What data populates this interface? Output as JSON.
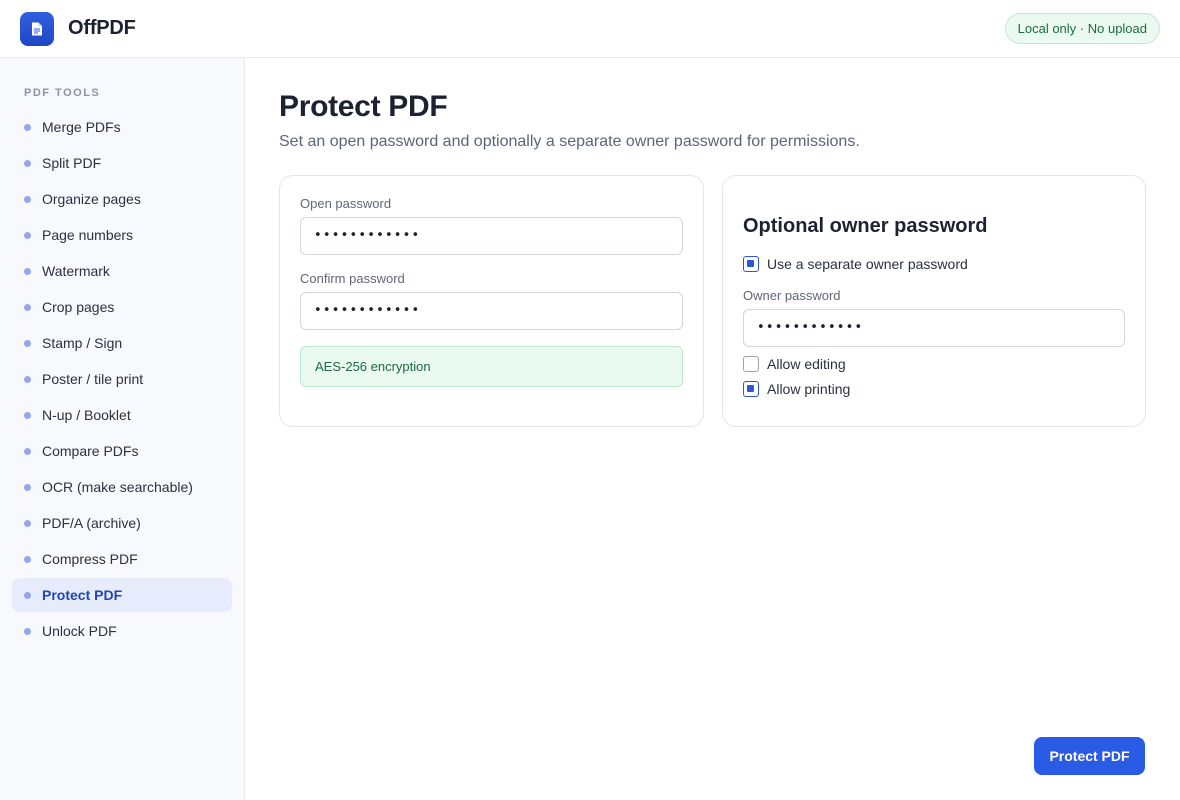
{
  "app": {
    "name": "OffPDF",
    "badge": "Local only · No upload",
    "icon": "document-icon"
  },
  "sidebar": {
    "heading": "PDF TOOLS",
    "items": [
      {
        "label": "Merge PDFs",
        "active": false
      },
      {
        "label": "Split PDF",
        "active": false
      },
      {
        "label": "Organize pages",
        "active": false
      },
      {
        "label": "Page numbers",
        "active": false
      },
      {
        "label": "Watermark",
        "active": false
      },
      {
        "label": "Crop pages",
        "active": false
      },
      {
        "label": "Stamp / Sign",
        "active": false
      },
      {
        "label": "Poster / tile print",
        "active": false
      },
      {
        "label": "N-up / Booklet",
        "active": false
      },
      {
        "label": "Compare PDFs",
        "active": false
      },
      {
        "label": "OCR (make searchable)",
        "active": false
      },
      {
        "label": "PDF/A (archive)",
        "active": false
      },
      {
        "label": "Compress PDF",
        "active": false
      },
      {
        "label": "Protect PDF",
        "active": true
      },
      {
        "label": "Unlock PDF",
        "active": false
      }
    ]
  },
  "main": {
    "title": "Protect PDF",
    "subtitle": "Set an open password and optionally a separate owner password for permissions.",
    "open_password": {
      "label": "Open password",
      "value": "••••••••••••"
    },
    "confirm_password": {
      "label": "Confirm password",
      "value": "••••••••••••"
    },
    "encryption_note": "AES-256 encryption",
    "owner": {
      "title": "Optional owner password",
      "use_separate": {
        "label": "Use a separate owner password",
        "checked": true
      },
      "password": {
        "label": "Owner password",
        "value": "••••••••••••"
      },
      "allow_editing": {
        "label": "Allow editing",
        "checked": false
      },
      "allow_printing": {
        "label": "Allow printing",
        "checked": true
      }
    },
    "submit_label": "Protect PDF"
  },
  "colors": {
    "accent": "#2a5be5",
    "success_bg": "#eafaf1",
    "success_text": "#1e6a3f",
    "sidebar_active_bg": "#e7ecfc"
  }
}
